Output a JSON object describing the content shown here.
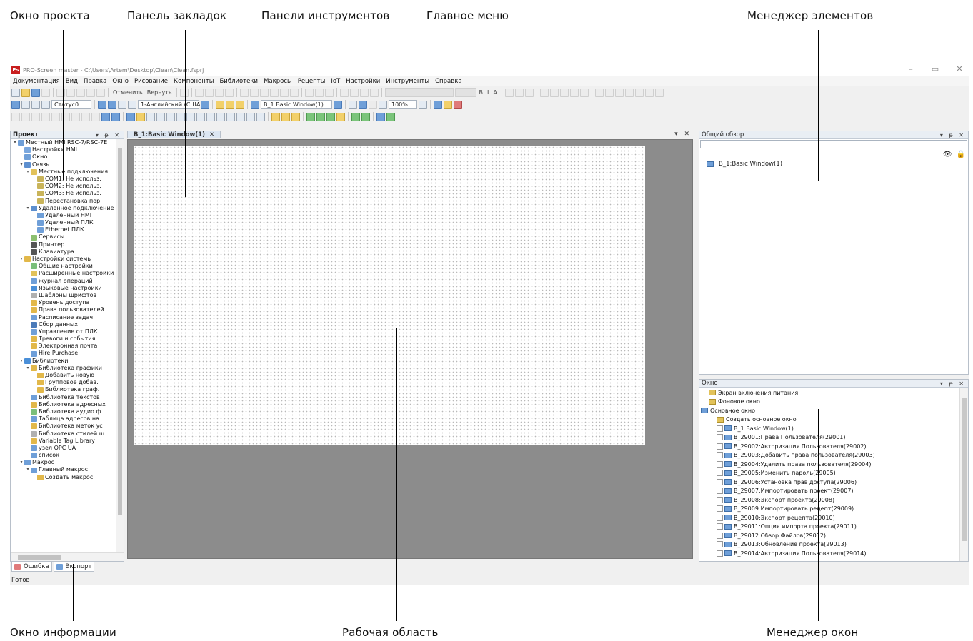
{
  "annotations": {
    "project_window": "Окно проекта",
    "bookmarks_panel": "Панель закладок",
    "toolbars": "Панели инструментов",
    "main_menu": "Главное меню",
    "element_manager": "Менеджер элементов",
    "info_window": "Окно информации",
    "work_area": "Рабочая область",
    "window_manager": "Менеджер окон"
  },
  "window": {
    "logo": "Ps",
    "title": "PRO-Screen master - C:\\Users\\Artem\\Desktop\\Clean\\Clean.fsprj",
    "controls": [
      "–",
      "▭",
      "✕"
    ]
  },
  "menu": [
    "Документация",
    "Вид",
    "Правка",
    "Окно",
    "Рисование",
    "Компоненты",
    "Библиотеки",
    "Макросы",
    "Рецепты",
    "IoT",
    "Настройки",
    "Инструменты",
    "Справка"
  ],
  "toolbar": {
    "undo": "Отменить",
    "redo": "Вернуть",
    "status_combo": "Статус0",
    "language_combo": "1-Английский (США)",
    "window_combo": "B_1:Basic Window(1)",
    "zoom_combo": "100%"
  },
  "project_panel": {
    "title": "Проект",
    "controls": "▾ ᵽ ✕",
    "tree": [
      {
        "d": 0,
        "label": "Местный HMI RSC-7/RSC-7E",
        "arrow": "▾",
        "color": "#6f9fd8"
      },
      {
        "d": 1,
        "label": "Настройки HMI",
        "color": "#7aa7de"
      },
      {
        "d": 1,
        "label": "Окно",
        "color": "#6f9fd8"
      },
      {
        "d": 1,
        "label": "Связь",
        "arrow": "▾",
        "color": "#5d8fcf"
      },
      {
        "d": 2,
        "label": "Местные подключения",
        "arrow": "▾",
        "color": "#e2c25a"
      },
      {
        "d": 3,
        "label": "COM1: Не использ.",
        "color": "#c9b45a"
      },
      {
        "d": 3,
        "label": "COM2: Не использ.",
        "color": "#c9b45a"
      },
      {
        "d": 3,
        "label": "COM3: Не использ.",
        "color": "#c9b45a"
      },
      {
        "d": 3,
        "label": "Перестановка пор.",
        "color": "#c9b45a"
      },
      {
        "d": 2,
        "label": "Удаленное подключение",
        "arrow": "▾",
        "color": "#5d8fcf"
      },
      {
        "d": 3,
        "label": "Удаленный HMI",
        "color": "#6f9fd8"
      },
      {
        "d": 3,
        "label": "Удаленный ПЛК",
        "color": "#6f9fd8"
      },
      {
        "d": 3,
        "label": "Ethernet ПЛК",
        "color": "#6f9fd8"
      },
      {
        "d": 2,
        "label": "Сервисы",
        "color": "#8cbf6f"
      },
      {
        "d": 2,
        "label": "Принтер",
        "color": "#555555"
      },
      {
        "d": 2,
        "label": "Клавиатура",
        "color": "#555555"
      },
      {
        "d": 1,
        "label": "Настройки системы",
        "arrow": "▾",
        "color": "#e2b84a"
      },
      {
        "d": 2,
        "label": "Общие настройки",
        "color": "#7bbf7b"
      },
      {
        "d": 2,
        "label": "Расширенные настройки",
        "color": "#e2c25a"
      },
      {
        "d": 2,
        "label": "журнал операций",
        "color": "#6f9fd8"
      },
      {
        "d": 2,
        "label": "Языковые настройки",
        "color": "#4a8fd8"
      },
      {
        "d": 2,
        "label": "Шаблоны шрифтов",
        "color": "#b0b0b0"
      },
      {
        "d": 2,
        "label": "Уровень доступа",
        "color": "#e2b84a"
      },
      {
        "d": 2,
        "label": "Права пользователей",
        "color": "#e2b84a"
      },
      {
        "d": 2,
        "label": "Расписание задач",
        "color": "#6f9fd8"
      },
      {
        "d": 2,
        "label": "Сбор данных",
        "color": "#4a7ab8"
      },
      {
        "d": 2,
        "label": "Управление от ПЛК",
        "color": "#6f9fd8"
      },
      {
        "d": 2,
        "label": "Тревоги и события",
        "color": "#e2b84a"
      },
      {
        "d": 2,
        "label": "Электронная почта",
        "color": "#e2b84a"
      },
      {
        "d": 2,
        "label": "Hire Purchase",
        "color": "#6f9fd8"
      },
      {
        "d": 1,
        "label": "Библиотеки",
        "arrow": "▾",
        "color": "#4a8fd8"
      },
      {
        "d": 2,
        "label": "Библиотека графики",
        "arrow": "▾",
        "color": "#e2b84a"
      },
      {
        "d": 3,
        "label": "Добавить новую",
        "color": "#e2b84a"
      },
      {
        "d": 3,
        "label": "Групповое добав.",
        "color": "#e2b84a"
      },
      {
        "d": 3,
        "label": "Библиотека граф.",
        "color": "#e2b84a"
      },
      {
        "d": 2,
        "label": "Библиотека текстов",
        "color": "#6f9fd8"
      },
      {
        "d": 2,
        "label": "Библиотека адресных",
        "color": "#e2b84a"
      },
      {
        "d": 2,
        "label": "Библиотека аудио ф.",
        "color": "#7bbf7b"
      },
      {
        "d": 2,
        "label": "Таблица адресов на",
        "color": "#6f9fd8"
      },
      {
        "d": 2,
        "label": "Библиотека меток ус",
        "color": "#e2b84a"
      },
      {
        "d": 2,
        "label": "Библиотека стилей ш",
        "color": "#b0b0b0"
      },
      {
        "d": 2,
        "label": "Variable Tag Library",
        "color": "#e2b84a"
      },
      {
        "d": 2,
        "label": "узел OPC UA",
        "color": "#6f9fd8"
      },
      {
        "d": 2,
        "label": "список",
        "color": "#6f9fd8"
      },
      {
        "d": 1,
        "label": "Макрос",
        "arrow": "▾",
        "color": "#6f9fd8"
      },
      {
        "d": 2,
        "label": "Главный макрос",
        "arrow": "▾",
        "color": "#6f9fd8"
      },
      {
        "d": 3,
        "label": "Создать макрос",
        "color": "#e2b84a"
      }
    ]
  },
  "info_tabs": [
    "Ошибка",
    "Экспорт"
  ],
  "status": "Готов",
  "doc_tab": {
    "label": "B_1:Basic Window(1)",
    "close": "✕",
    "controls": "▾ ✕"
  },
  "overview_panel": {
    "title": "Общий обзор",
    "controls": "▾ ᵽ ✕",
    "item": "B_1:Basic Window(1)"
  },
  "window_panel": {
    "title": "Окно",
    "controls": "▾ ᵽ ✕",
    "items": [
      {
        "d": 1,
        "label": "Экран включения питания",
        "kind": "plain"
      },
      {
        "d": 1,
        "label": "Фоновое окно",
        "kind": "plain"
      },
      {
        "d": 0,
        "label": "Основное окно",
        "kind": "folder"
      },
      {
        "d": 2,
        "label": "Создать основное окно",
        "kind": "plain"
      },
      {
        "d": 2,
        "label": "B_1:Basic Window(1)",
        "kind": "win"
      },
      {
        "d": 2,
        "label": "B_29001:Права Пользователя(29001)",
        "kind": "win"
      },
      {
        "d": 2,
        "label": "B_29002:Авторизация Пользователя(29002)",
        "kind": "win"
      },
      {
        "d": 2,
        "label": "B_29003:Добавить права пользователя(29003)",
        "kind": "win"
      },
      {
        "d": 2,
        "label": "B_29004:Удалить права пользователя(29004)",
        "kind": "win"
      },
      {
        "d": 2,
        "label": "B_29005:Изменить пароль(29005)",
        "kind": "win"
      },
      {
        "d": 2,
        "label": "B_29006:Установка прав доступа(29006)",
        "kind": "win"
      },
      {
        "d": 2,
        "label": "B_29007:Импортировать проект(29007)",
        "kind": "win"
      },
      {
        "d": 2,
        "label": "B_29008:Экспорт проекта(29008)",
        "kind": "win"
      },
      {
        "d": 2,
        "label": "B_29009:Импортировать рецепт(29009)",
        "kind": "win"
      },
      {
        "d": 2,
        "label": "B_29010:Экспорт рецепта(29010)",
        "kind": "win"
      },
      {
        "d": 2,
        "label": "B_29011:Опция импорта проекта(29011)",
        "kind": "win"
      },
      {
        "d": 2,
        "label": "B_29012:Обзор Файлов(29012)",
        "kind": "win"
      },
      {
        "d": 2,
        "label": "B_29013:Обновление проекта(29013)",
        "kind": "win"
      },
      {
        "d": 2,
        "label": "B_29014:Авторизация Пользователя(29014)",
        "kind": "win"
      }
    ]
  }
}
